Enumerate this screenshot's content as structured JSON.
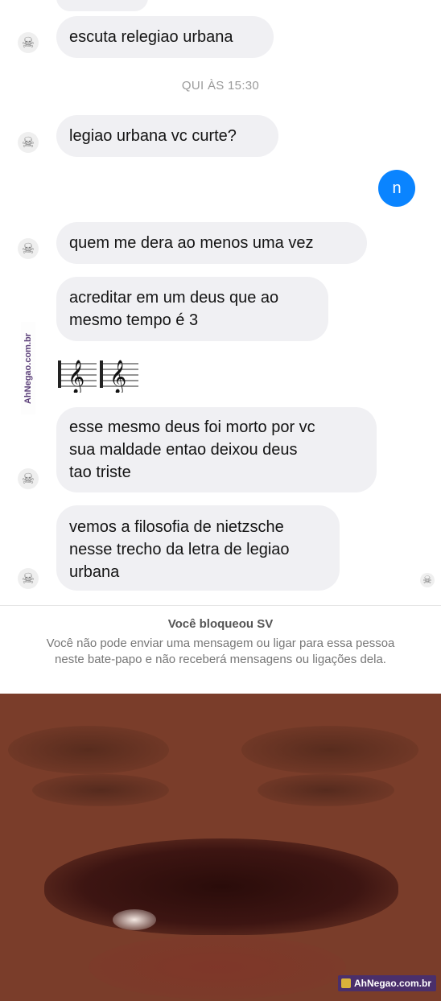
{
  "chat": {
    "messages": [
      {
        "text": "escuta relegiao urbana"
      },
      {
        "text": "legiao urbana vc curte?"
      },
      {
        "text": "quem me dera ao menos uma vez"
      },
      {
        "text": "acreditar em um deus que ao\nmesmo tempo é 3"
      },
      {
        "text": "esse mesmo deus foi morto por vc\nsua maldade entao deixou deus\ntao triste"
      },
      {
        "text": "vemos a filosofia de nietzsche\nnesse trecho da letra de legiao\nurbana"
      }
    ],
    "timestamp": "QUI ÀS 15:30",
    "sent_message": "n",
    "avatar_icon": "skull-icon",
    "music_icon": "treble-clef-icon"
  },
  "blocked": {
    "title": "Você bloqueou SV",
    "body": "Você não pode enviar uma mensagem ou ligar para essa pessoa neste bate-papo e não receberá mensagens ou ligações dela."
  },
  "watermark": {
    "side": "AhNegao.com.br",
    "brand": "AhNegao.com.br"
  },
  "colors": {
    "bubble": "#f0f0f3",
    "sent_bubble": "#0a84ff",
    "brand_bg": "#4a2f6b"
  }
}
